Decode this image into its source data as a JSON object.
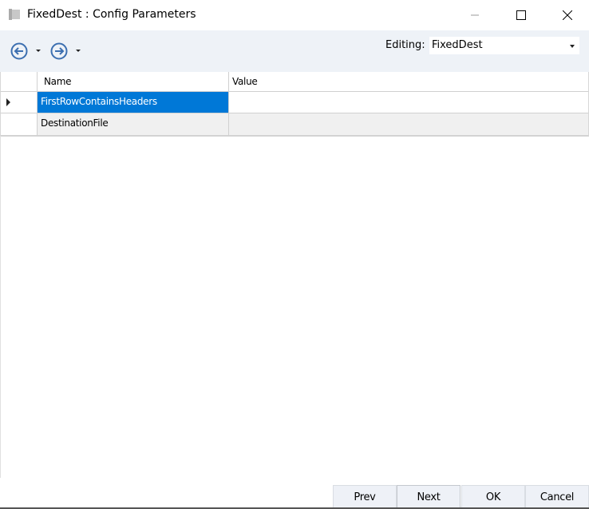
{
  "window": {
    "title": "FixedDest : Config Parameters"
  },
  "toolbar": {
    "editing_label": "Editing:",
    "editing_value": "FixedDest"
  },
  "grid": {
    "columns": [
      "Name",
      "Value"
    ],
    "rows": [
      {
        "name": "FirstRowContainsHeaders",
        "value": ""
      },
      {
        "name": "DestinationFile",
        "value": ""
      }
    ]
  },
  "buttons": {
    "prev": "Prev",
    "next": "Next",
    "ok": "OK",
    "cancel": "Cancel"
  },
  "colors": {
    "selection": "#0078d7",
    "toolbar_bg": "#eef2f7",
    "icon_blue": "#3c6fb0"
  }
}
